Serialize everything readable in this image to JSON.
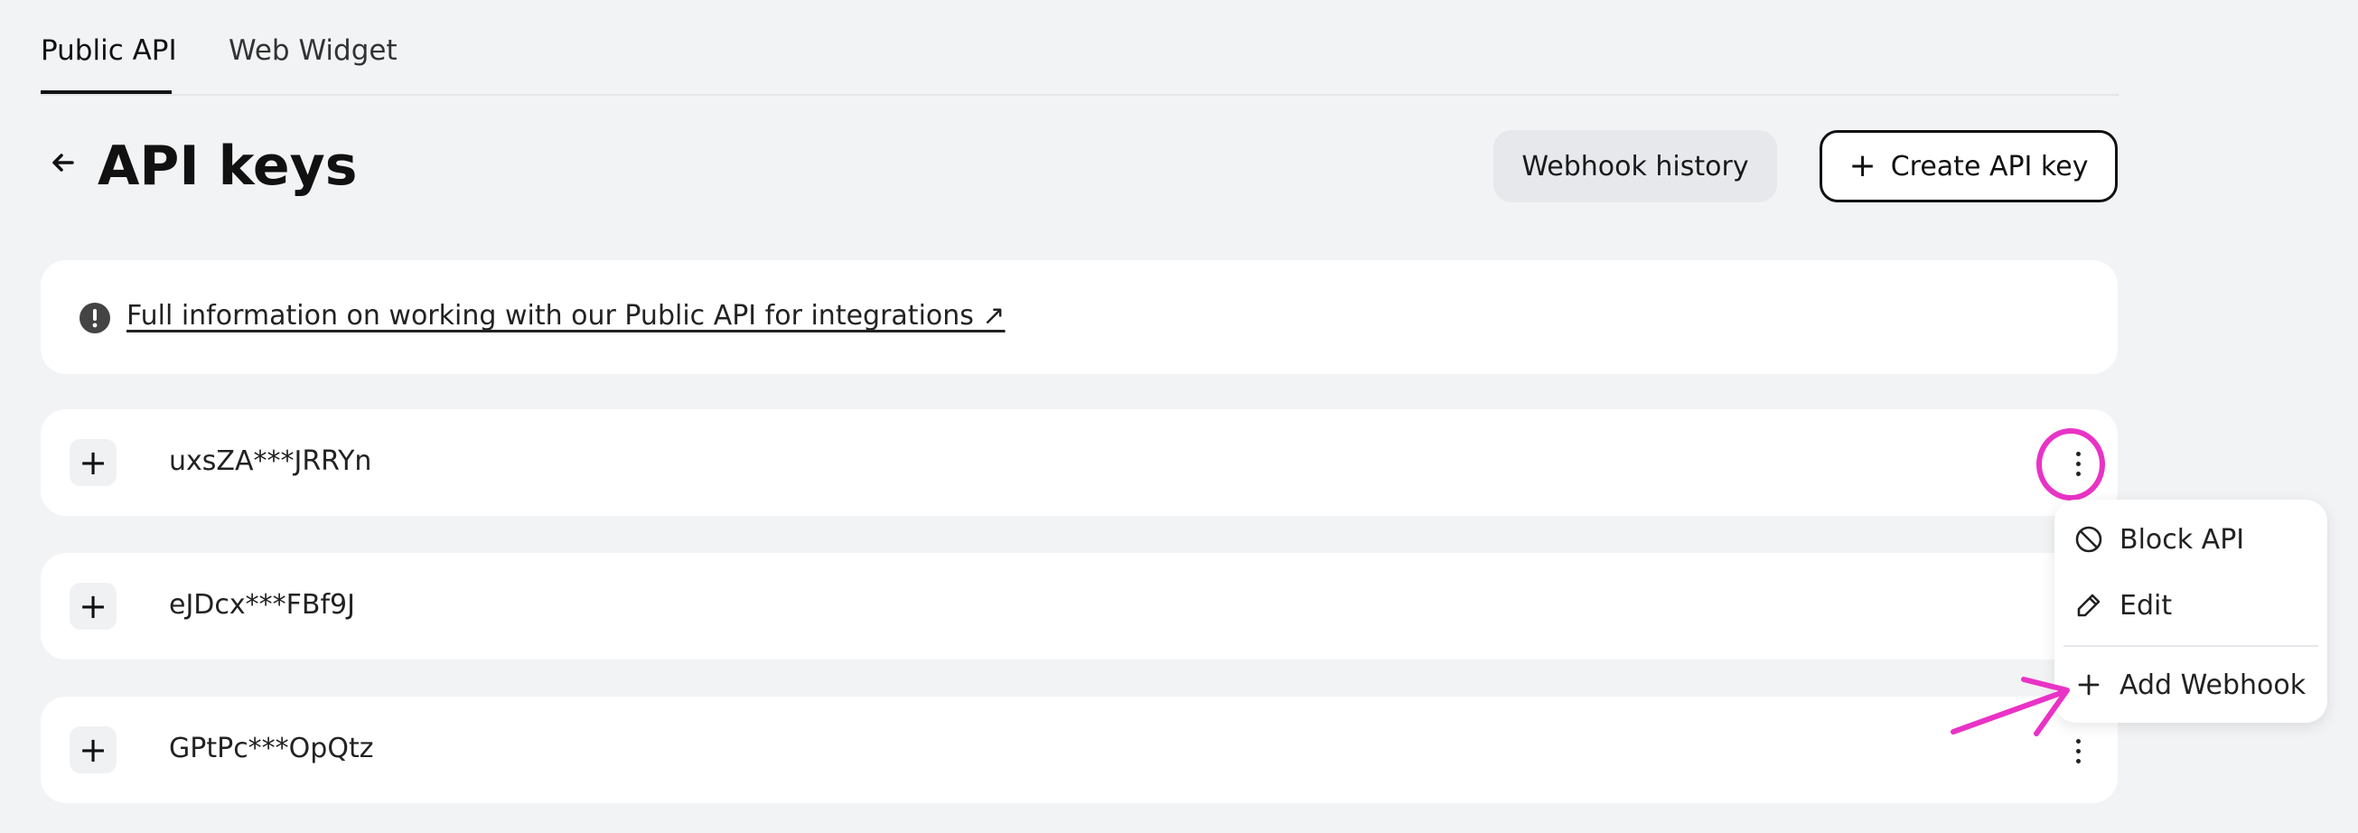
{
  "tabs": [
    {
      "label": "Public API",
      "active": true
    },
    {
      "label": "Web Widget",
      "active": false
    }
  ],
  "header": {
    "title": "API keys",
    "webhook_history_label": "Webhook history",
    "create_label": "Create API key"
  },
  "info": {
    "link_text": "Full information on working with our Public API for integrations ↗"
  },
  "keys": [
    {
      "value": "uxsZA***JRRYn"
    },
    {
      "value": "eJDcx***FBf9J"
    },
    {
      "value": "GPtPc***OpQtz"
    }
  ],
  "menu": {
    "items": [
      {
        "label": "Block API",
        "icon": "block-icon"
      },
      {
        "label": "Edit",
        "icon": "pencil-icon"
      },
      {
        "label": "Add Webhook",
        "icon": "plus-icon"
      }
    ]
  },
  "colors": {
    "background": "#f2f3f5",
    "annotation": "#e933c6",
    "secondary_button": "#e6e8ec"
  }
}
